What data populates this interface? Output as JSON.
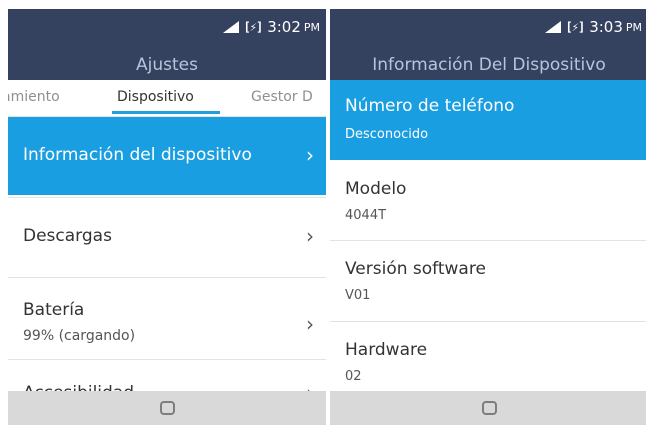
{
  "left_screen": {
    "status": {
      "time": "3:02",
      "ampm": "PM",
      "battery_glyph": "[⚡]",
      "signal_icon": "signal-icon"
    },
    "title": "Ajustes",
    "tabs": [
      {
        "label": "amiento",
        "active": false
      },
      {
        "label": "Dispositivo",
        "active": true
      },
      {
        "label": "Gestor D",
        "active": false
      }
    ],
    "items": [
      {
        "title": "Información del dispositivo",
        "subtitle": "",
        "selected": true
      },
      {
        "title": "Descargas",
        "subtitle": ""
      },
      {
        "title": "Batería",
        "subtitle": "99% (cargando)"
      },
      {
        "title": "Accesibilidad",
        "subtitle": ""
      }
    ],
    "chevron": "›"
  },
  "right_screen": {
    "status": {
      "time": "3:03",
      "ampm": "PM",
      "battery_glyph": "[⚡]",
      "signal_icon": "signal-icon"
    },
    "title": "Información Del Dispositivo",
    "items": [
      {
        "title": "Número de teléfono",
        "value": "Desconocido",
        "selected": true
      },
      {
        "title": "Modelo",
        "value": "4044T"
      },
      {
        "title": "Versión software",
        "value": "V01"
      },
      {
        "title": "Hardware",
        "value": "02"
      }
    ]
  },
  "colors": {
    "header_bg": "#34415f",
    "title_text": "#b9c4db",
    "accent": "#1a9ee2",
    "navbar_bg": "#d9d9d9"
  }
}
